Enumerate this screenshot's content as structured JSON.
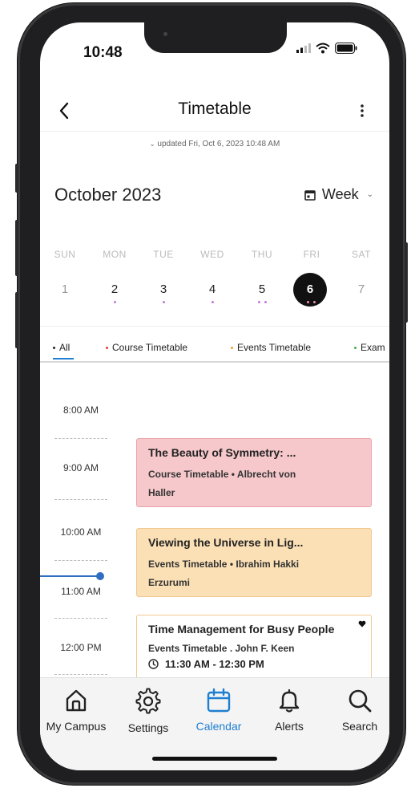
{
  "status_bar": {
    "time": "10:48"
  },
  "header": {
    "title": "Timetable"
  },
  "updated_text": "updated Fri, Oct 6, 2023 10:48 AM",
  "calendar": {
    "month_label": "October 2023",
    "view_label": "Week",
    "weekdays": [
      "SUN",
      "MON",
      "TUE",
      "WED",
      "THU",
      "FRI",
      "SAT"
    ],
    "days": [
      "1",
      "2",
      "3",
      "4",
      "5",
      "6",
      "7"
    ],
    "selected_day": "6"
  },
  "filters": [
    {
      "label": "All",
      "dot_color": "#222222",
      "active": true
    },
    {
      "label": "Course Timetable",
      "dot_color": "#e53935"
    },
    {
      "label": "Events Timetable",
      "dot_color": "#f0a030"
    },
    {
      "label": "Exam",
      "dot_color": "#43b049"
    }
  ],
  "timeline": {
    "time_labels": [
      "8:00 AM",
      "9:00 AM",
      "10:00 AM",
      "11:00 AM",
      "12:00 PM"
    ]
  },
  "events": [
    {
      "title": "The Beauty of Symmetry: ...",
      "subtitle_line1": "Course Timetable • Albrecht von",
      "subtitle_line2": "Haller",
      "color": "#f6c8cb"
    },
    {
      "title": "Viewing the Universe in Lig...",
      "subtitle_line1": "Events Timetable • Ibrahim Hakki",
      "subtitle_line2": "Erzurumi",
      "color": "#fbe0b6"
    },
    {
      "title": "Time Management for Busy People",
      "subtitle_line1": "Events Timetable . John F. Keen",
      "time_range": "11:30 AM - 12:30 PM",
      "color": "#ffffff"
    }
  ],
  "tabbar": [
    {
      "label": "My Campus",
      "icon": "home-icon"
    },
    {
      "label": "Settings",
      "icon": "gear-icon"
    },
    {
      "label": "Calendar",
      "icon": "calendar-icon",
      "active": true
    },
    {
      "label": "Alerts",
      "icon": "bell-icon"
    },
    {
      "label": "Search",
      "icon": "search-icon"
    }
  ],
  "colors": {
    "accent": "#1f7fd0",
    "now_indicator": "#2f6fc0",
    "course": "#e53935",
    "events": "#f0a030",
    "exam": "#43b049"
  }
}
